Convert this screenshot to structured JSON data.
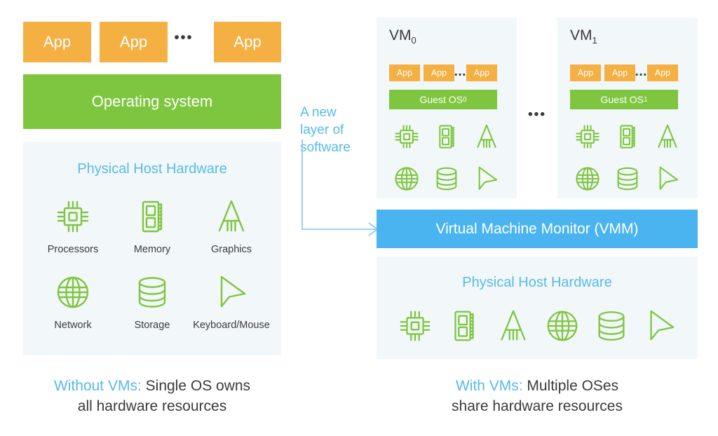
{
  "colors": {
    "app_orange": "#f5b043",
    "os_green": "#7ec63f",
    "vmm_blue": "#4ab4f0",
    "accent_blue": "#57bbe8",
    "panel_bg": "#f2f7fa",
    "icon_green": "#7ec63f",
    "text_dark": "#3b3b3b"
  },
  "left": {
    "apps": [
      "App",
      "App",
      "App"
    ],
    "apps_ellipsis": "•••",
    "operating_system": "Operating system",
    "hardware_title": "Physical Host Hardware",
    "hardware_items": [
      {
        "label": "Processors",
        "icon": "cpu-icon"
      },
      {
        "label": "Memory",
        "icon": "memory-icon"
      },
      {
        "label": "Graphics",
        "icon": "graphics-icon"
      },
      {
        "label": "Network",
        "icon": "network-globe-icon"
      },
      {
        "label": "Storage",
        "icon": "storage-database-icon"
      },
      {
        "label": "Keyboard/Mouse",
        "icon": "cursor-pointer-icon"
      }
    ],
    "caption_highlight": "Without VMs:",
    "caption_rest": " Single OS owns",
    "caption_line2": "all hardware resources"
  },
  "annotation": {
    "line1": "A new",
    "line2": "layer of",
    "line3": "software",
    "arrow_icon": "elbow-arrow-right-icon"
  },
  "right": {
    "vms": [
      {
        "title_base": "VM",
        "title_sub": "0",
        "apps": [
          "App",
          "App",
          "App"
        ],
        "apps_ellipsis": "•••",
        "guest_os_base": "Guest OS",
        "guest_os_sub": "0",
        "icons": [
          "cpu-icon",
          "memory-icon",
          "graphics-icon",
          "network-globe-icon",
          "storage-database-icon",
          "cursor-pointer-icon"
        ]
      },
      {
        "title_base": "VM",
        "title_sub": "1",
        "apps": [
          "App",
          "App",
          "App"
        ],
        "apps_ellipsis": "•••",
        "guest_os_base": "Guest OS",
        "guest_os_sub": "1",
        "icons": [
          "cpu-icon",
          "memory-icon",
          "graphics-icon",
          "network-globe-icon",
          "storage-database-icon",
          "cursor-pointer-icon"
        ]
      }
    ],
    "vm_gap_ellipsis": "•••",
    "vmm_label": "Virtual Machine Monitor (VMM)",
    "hardware_title": "Physical Host Hardware",
    "hardware_icons": [
      "cpu-icon",
      "memory-icon",
      "graphics-icon",
      "network-globe-icon",
      "storage-database-icon",
      "cursor-pointer-icon"
    ],
    "caption_highlight": "With VMs:",
    "caption_rest": " Multiple OSes",
    "caption_line2": "share hardware resources"
  }
}
